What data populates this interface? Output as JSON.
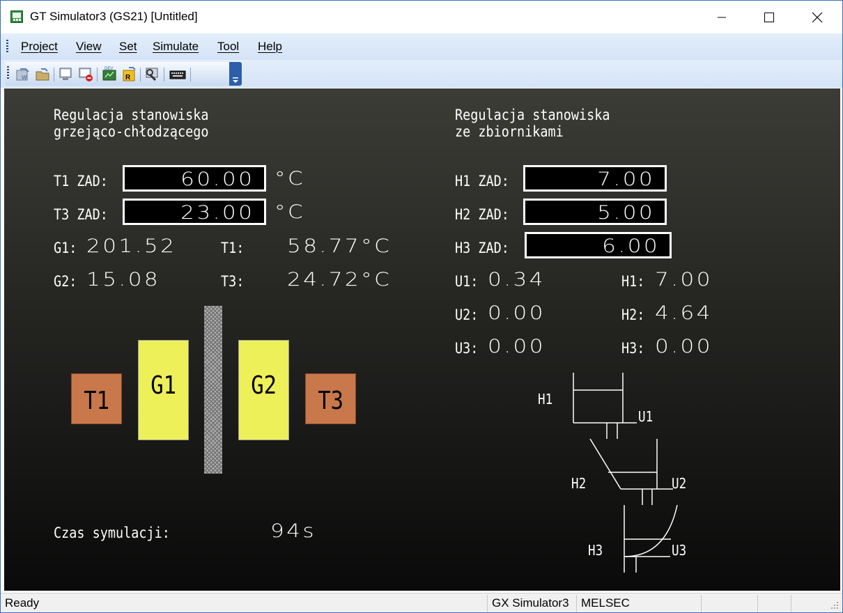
{
  "window": {
    "title": "GT Simulator3 (GS21)  [Untitled]"
  },
  "menu": {
    "items": [
      "Project",
      "View",
      "Set",
      "Simulate",
      "Tool",
      "Help"
    ]
  },
  "toolbar": {
    "buttons": [
      "write-to-simulator-icon",
      "read-from-simulator-icon",
      "monitor-icon",
      "stop-monitor-icon",
      "device-monitor-icon",
      "script-icon",
      "debug-icon",
      "keyboard-icon"
    ]
  },
  "screen": {
    "left_section": {
      "title_line1": "Regulacja stanowiska",
      "title_line2": "grzejąco-chłodzącego",
      "t1_zad_label": "T1 ZAD:",
      "t1_zad_value": "60.00",
      "t3_zad_label": "T3 ZAD:",
      "t3_zad_value": "23.00",
      "unit": "°C",
      "g1_label": "G1:",
      "g1_value": "201.52",
      "g2_label": "G2:",
      "g2_value": "15.08",
      "t1_label": "T1:",
      "t1_value": "58.77°C",
      "t3_label": "T3:",
      "t3_value": "24.72°C",
      "blocks": {
        "t1": "T1",
        "g1": "G1",
        "g2": "G2",
        "t3": "T3"
      },
      "sim_time_label": "Czas symulacji:",
      "sim_time_value": "94s"
    },
    "right_section": {
      "title_line1": "Regulacja stanowiska",
      "title_line2": "ze zbiornikami",
      "h1_zad_label": "H1 ZAD:",
      "h1_zad_value": "7.00",
      "h2_zad_label": "H2 ZAD:",
      "h2_zad_value": "5.00",
      "h3_zad_label": "H3 ZAD:",
      "h3_zad_value": "6.00",
      "u1_label": "U1:",
      "u1_value": "0.34",
      "u2_label": "U2:",
      "u2_value": "0.00",
      "u3_label": "U3:",
      "u3_value": "0.00",
      "h1_label": "H1:",
      "h1_value": "7.00",
      "h2_label": "H2:",
      "h2_value": "4.64",
      "h3_label": "H3:",
      "h3_value": "0.00",
      "tanks": {
        "h1": "H1",
        "u1": "U1",
        "h2": "H2",
        "u2": "U2",
        "h3": "H3",
        "u3": "U3"
      }
    }
  },
  "statusbar": {
    "status": "Ready",
    "simulator": "GX Simulator3",
    "plc": "MELSEC"
  }
}
